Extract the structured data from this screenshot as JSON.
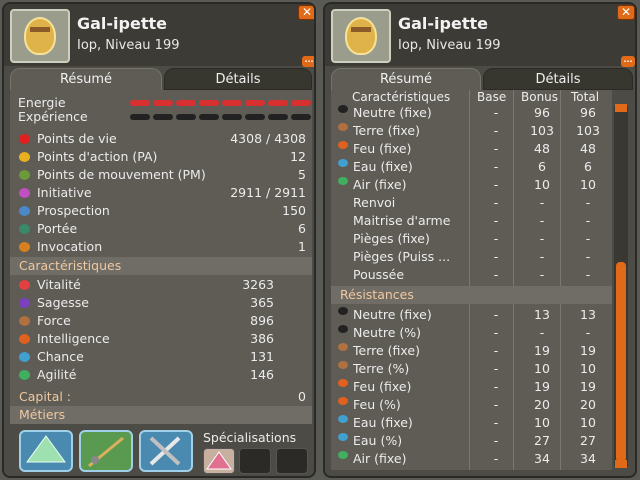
{
  "left": {
    "name": "Gal-ipette",
    "subtitle": "Iop, Niveau 199",
    "tabs": [
      "Résumé",
      "Détails"
    ],
    "energy_label": "Energie",
    "xp_label": "Expérience",
    "stats": [
      {
        "icon": "heart-icon",
        "color": "#e02020",
        "label": "Points de vie",
        "value": "4308 / 4308"
      },
      {
        "icon": "star-icon",
        "color": "#e8b020",
        "label": "Points d'action (PA)",
        "value": "12"
      },
      {
        "icon": "boot-icon",
        "color": "#6a9a3a",
        "label": "Points de mouvement (PM)",
        "value": "5"
      },
      {
        "icon": "initiative-icon",
        "color": "#c050c0",
        "label": "Initiative",
        "value": "2911 / 2911"
      },
      {
        "icon": "prospection-icon",
        "color": "#4a88c8",
        "label": "Prospection",
        "value": "150"
      },
      {
        "icon": "range-icon",
        "color": "#3a8a6a",
        "label": "Portée",
        "value": "6"
      },
      {
        "icon": "summon-icon",
        "color": "#d88020",
        "label": "Invocation",
        "value": "1"
      }
    ],
    "carac_title": "Caractéristiques",
    "caracs": [
      {
        "icon": "vitality-icon",
        "color": "#e04040",
        "label": "Vitalité",
        "value": "3263"
      },
      {
        "icon": "wisdom-icon",
        "color": "#7a40c0",
        "label": "Sagesse",
        "value": "365"
      },
      {
        "icon": "strength-icon",
        "color": "#b07040",
        "label": "Force",
        "value": "896"
      },
      {
        "icon": "intelligence-icon",
        "color": "#e06020",
        "label": "Intelligence",
        "value": "386"
      },
      {
        "icon": "chance-icon",
        "color": "#40a0d0",
        "label": "Chance",
        "value": "131"
      },
      {
        "icon": "agility-icon",
        "color": "#40b060",
        "label": "Agilité",
        "value": "146"
      }
    ],
    "capital_label": "Capital :",
    "capital_value": "0",
    "jobs_title": "Métiers",
    "spec_label": "Spécialisations"
  },
  "right": {
    "name": "Gal-ipette",
    "subtitle": "Iop, Niveau 199",
    "tabs": [
      "Résumé",
      "Détails"
    ],
    "headers": {
      "carac": "Caractéristiques",
      "base": "Base",
      "bonus": "Bonus",
      "total": "Total"
    },
    "rows": [
      {
        "icon": "neutral-icon",
        "color": "#222",
        "label": "Neutre (fixe)",
        "base": "-",
        "bonus": "96",
        "total": "96"
      },
      {
        "icon": "earth-icon",
        "color": "#b07040",
        "label": "Terre (fixe)",
        "base": "-",
        "bonus": "103",
        "total": "103"
      },
      {
        "icon": "fire-icon",
        "color": "#e06020",
        "label": "Feu (fixe)",
        "base": "-",
        "bonus": "48",
        "total": "48"
      },
      {
        "icon": "water-icon",
        "color": "#40a0d0",
        "label": "Eau (fixe)",
        "base": "-",
        "bonus": "6",
        "total": "6"
      },
      {
        "icon": "air-icon",
        "color": "#40b060",
        "label": "Air (fixe)",
        "base": "-",
        "bonus": "10",
        "total": "10"
      },
      {
        "icon": "",
        "color": "",
        "label": "Renvoi",
        "base": "-",
        "bonus": "-",
        "total": "-"
      },
      {
        "icon": "",
        "color": "",
        "label": "Maitrise d'arme",
        "base": "-",
        "bonus": "-",
        "total": "-"
      },
      {
        "icon": "",
        "color": "",
        "label": "Pièges (fixe)",
        "base": "-",
        "bonus": "-",
        "total": "-"
      },
      {
        "icon": "",
        "color": "",
        "label": "Pièges (Puiss ...",
        "base": "-",
        "bonus": "-",
        "total": "-"
      },
      {
        "icon": "",
        "color": "",
        "label": "Poussée",
        "base": "-",
        "bonus": "-",
        "total": "-"
      }
    ],
    "res_title": "Résistances",
    "res_rows": [
      {
        "icon": "neutral-icon",
        "color": "#222",
        "label": "Neutre (fixe)",
        "base": "-",
        "bonus": "13",
        "total": "13"
      },
      {
        "icon": "neutral-icon",
        "color": "#222",
        "label": "Neutre (%)",
        "base": "-",
        "bonus": "-",
        "total": "-"
      },
      {
        "icon": "earth-icon",
        "color": "#b07040",
        "label": "Terre (fixe)",
        "base": "-",
        "bonus": "19",
        "total": "19"
      },
      {
        "icon": "earth-icon",
        "color": "#b07040",
        "label": "Terre (%)",
        "base": "-",
        "bonus": "10",
        "total": "10"
      },
      {
        "icon": "fire-icon",
        "color": "#e06020",
        "label": "Feu (fixe)",
        "base": "-",
        "bonus": "19",
        "total": "19"
      },
      {
        "icon": "fire-icon",
        "color": "#e06020",
        "label": "Feu (%)",
        "base": "-",
        "bonus": "20",
        "total": "20"
      },
      {
        "icon": "water-icon",
        "color": "#40a0d0",
        "label": "Eau (fixe)",
        "base": "-",
        "bonus": "10",
        "total": "10"
      },
      {
        "icon": "water-icon",
        "color": "#40a0d0",
        "label": "Eau (%)",
        "base": "-",
        "bonus": "27",
        "total": "27"
      },
      {
        "icon": "air-icon",
        "color": "#40b060",
        "label": "Air (fixe)",
        "base": "-",
        "bonus": "34",
        "total": "34"
      }
    ]
  }
}
